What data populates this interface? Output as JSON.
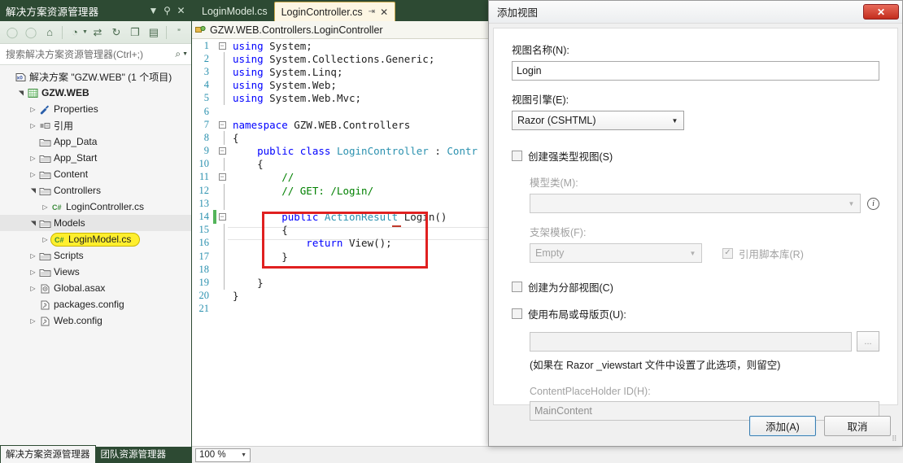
{
  "solution_explorer": {
    "title": "解决方案资源管理器",
    "header_icons": {
      "dropdown": "chevron-down-icon",
      "pin": "pin-icon",
      "close": "close-icon"
    },
    "toolbar": [
      {
        "name": "back-icon",
        "glyph": "↺"
      },
      {
        "name": "forward-icon",
        "glyph": "↻"
      },
      {
        "name": "home-icon",
        "glyph": "⌂"
      },
      {
        "name": "pending-changes-icon",
        "glyph": "◔"
      },
      {
        "name": "sync-with-active-document-icon",
        "glyph": "⇄"
      },
      {
        "name": "refresh-icon",
        "glyph": "↻"
      },
      {
        "name": "collapse-all-icon",
        "glyph": "⧉"
      },
      {
        "name": "show-all-files-icon",
        "glyph": "▤"
      },
      {
        "name": "properties-icon",
        "glyph": "»"
      }
    ],
    "search_placeholder": "搜索解决方案资源管理器(Ctrl+;)",
    "tree": [
      {
        "indent": 0,
        "expander": "",
        "icon": "solution-icon",
        "label": "解决方案 \"GZW.WEB\" (1 个项目)",
        "bold": false,
        "selected": false,
        "highlight": false
      },
      {
        "indent": 1,
        "expander": "▲",
        "icon": "project-icon",
        "label": "GZW.WEB",
        "bold": true,
        "selected": false,
        "highlight": false
      },
      {
        "indent": 2,
        "expander": "▷",
        "icon": "wrench-icon",
        "label": "Properties",
        "bold": false,
        "selected": false,
        "highlight": false
      },
      {
        "indent": 2,
        "expander": "▷",
        "icon": "references-icon",
        "label": "引用",
        "bold": false,
        "selected": false,
        "highlight": false
      },
      {
        "indent": 2,
        "expander": "",
        "icon": "folder-icon",
        "label": "App_Data",
        "bold": false,
        "selected": false,
        "highlight": false
      },
      {
        "indent": 2,
        "expander": "▷",
        "icon": "folder-icon",
        "label": "App_Start",
        "bold": false,
        "selected": false,
        "highlight": false
      },
      {
        "indent": 2,
        "expander": "▷",
        "icon": "folder-icon",
        "label": "Content",
        "bold": false,
        "selected": false,
        "highlight": false
      },
      {
        "indent": 2,
        "expander": "▲",
        "icon": "folder-icon",
        "label": "Controllers",
        "bold": false,
        "selected": false,
        "highlight": false
      },
      {
        "indent": 3,
        "expander": "▷",
        "icon": "csharp-icon",
        "label": "LoginController.cs",
        "bold": false,
        "selected": false,
        "highlight": false
      },
      {
        "indent": 2,
        "expander": "▲",
        "icon": "folder-icon",
        "label": "Models",
        "bold": false,
        "selected": true,
        "highlight": false
      },
      {
        "indent": 3,
        "expander": "▷",
        "icon": "csharp-icon",
        "label": "LoginModel.cs",
        "bold": false,
        "selected": false,
        "highlight": true
      },
      {
        "indent": 2,
        "expander": "▷",
        "icon": "folder-icon",
        "label": "Scripts",
        "bold": false,
        "selected": false,
        "highlight": false
      },
      {
        "indent": 2,
        "expander": "▷",
        "icon": "folder-icon",
        "label": "Views",
        "bold": false,
        "selected": false,
        "highlight": false
      },
      {
        "indent": 2,
        "expander": "▷",
        "icon": "asax-icon",
        "label": "Global.asax",
        "bold": false,
        "selected": false,
        "highlight": false
      },
      {
        "indent": 2,
        "expander": "",
        "icon": "config-icon",
        "label": "packages.config",
        "bold": false,
        "selected": false,
        "highlight": false
      },
      {
        "indent": 2,
        "expander": "▷",
        "icon": "config-icon",
        "label": "Web.config",
        "bold": false,
        "selected": false,
        "highlight": false
      }
    ],
    "bottom_tabs": [
      {
        "label": "解决方案资源管理器",
        "active": true
      },
      {
        "label": "团队资源管理器",
        "active": false
      }
    ]
  },
  "editor": {
    "tabs": [
      {
        "label": "LoginModel.cs",
        "active": false,
        "pinned": false
      },
      {
        "label": "LoginController.cs",
        "active": true,
        "pinned": true
      }
    ],
    "tab_pin_glyph": "⇥",
    "tab_close_glyph": "✕",
    "navbar": "GZW.WEB.Controllers.LoginController",
    "navbar_icon": "class-icon",
    "zoom_level": "100 %",
    "code_lines": [
      {
        "n": 1,
        "fold": "−",
        "guide": false,
        "changed": false,
        "segs": [
          {
            "t": "using ",
            "c": "kw"
          },
          {
            "t": "System;",
            "c": ""
          }
        ]
      },
      {
        "n": 2,
        "fold": "",
        "guide": true,
        "changed": false,
        "segs": [
          {
            "t": "using ",
            "c": "kw"
          },
          {
            "t": "System.Collections.Generic;",
            "c": ""
          }
        ]
      },
      {
        "n": 3,
        "fold": "",
        "guide": true,
        "changed": false,
        "segs": [
          {
            "t": "using ",
            "c": "kw"
          },
          {
            "t": "System.Linq;",
            "c": ""
          }
        ]
      },
      {
        "n": 4,
        "fold": "",
        "guide": true,
        "changed": false,
        "segs": [
          {
            "t": "using ",
            "c": "kw"
          },
          {
            "t": "System.Web;",
            "c": ""
          }
        ]
      },
      {
        "n": 5,
        "fold": "",
        "guide": true,
        "changed": false,
        "segs": [
          {
            "t": "using ",
            "c": "kw"
          },
          {
            "t": "System.Web.Mvc;",
            "c": ""
          }
        ]
      },
      {
        "n": 6,
        "fold": "",
        "guide": false,
        "changed": false,
        "segs": []
      },
      {
        "n": 7,
        "fold": "−",
        "guide": false,
        "changed": false,
        "segs": [
          {
            "t": "namespace ",
            "c": "kw"
          },
          {
            "t": "GZW.WEB.Controllers",
            "c": ""
          }
        ]
      },
      {
        "n": 8,
        "fold": "",
        "guide": true,
        "changed": false,
        "segs": [
          {
            "t": "{",
            "c": ""
          }
        ]
      },
      {
        "n": 9,
        "fold": "−",
        "guide": true,
        "changed": false,
        "segs": [
          {
            "t": "    public class ",
            "c": "kw"
          },
          {
            "t": "LoginController",
            "c": "ty"
          },
          {
            "t": " : ",
            "c": ""
          },
          {
            "t": "Contr",
            "c": "ty"
          }
        ]
      },
      {
        "n": 10,
        "fold": "",
        "guide": true,
        "changed": false,
        "segs": [
          {
            "t": "    {",
            "c": ""
          }
        ]
      },
      {
        "n": 11,
        "fold": "−",
        "guide": true,
        "changed": false,
        "segs": [
          {
            "t": "        //",
            "c": "cm"
          }
        ]
      },
      {
        "n": 12,
        "fold": "",
        "guide": true,
        "changed": false,
        "segs": [
          {
            "t": "        // GET: /Login/",
            "c": "cm"
          }
        ]
      },
      {
        "n": 13,
        "fold": "",
        "guide": true,
        "changed": false,
        "segs": []
      },
      {
        "n": 14,
        "fold": "−",
        "guide": true,
        "changed": true,
        "segs": [
          {
            "t": "        public ",
            "c": "kw"
          },
          {
            "t": "ActionResult",
            "c": "ty"
          },
          {
            "t": " Login()",
            "c": ""
          }
        ]
      },
      {
        "n": 15,
        "fold": "",
        "guide": true,
        "changed": false,
        "segs": [
          {
            "t": "        {",
            "c": ""
          }
        ]
      },
      {
        "n": 16,
        "fold": "",
        "guide": true,
        "changed": false,
        "segs": [
          {
            "t": "            return ",
            "c": "kw"
          },
          {
            "t": "View();",
            "c": ""
          }
        ]
      },
      {
        "n": 17,
        "fold": "",
        "guide": true,
        "changed": false,
        "segs": [
          {
            "t": "        }",
            "c": ""
          }
        ]
      },
      {
        "n": 18,
        "fold": "",
        "guide": true,
        "changed": false,
        "segs": []
      },
      {
        "n": 19,
        "fold": "",
        "guide": true,
        "changed": false,
        "segs": [
          {
            "t": "    }",
            "c": ""
          }
        ]
      },
      {
        "n": 20,
        "fold": "",
        "guide": false,
        "changed": false,
        "segs": [
          {
            "t": "}",
            "c": ""
          }
        ]
      },
      {
        "n": 21,
        "fold": "",
        "guide": false,
        "changed": false,
        "segs": []
      }
    ],
    "annotation": {
      "name": "red-highlight-box",
      "color": "#e02020"
    }
  },
  "dialog": {
    "title": "添加视图",
    "close_glyph": "✕",
    "view_name_label": "视图名称(N):",
    "view_name_value": "Login",
    "view_engine_label": "视图引擎(E):",
    "view_engine_value": "Razor (CSHTML)",
    "strongly_typed_label": "创建强类型视图(S)",
    "strongly_typed_checked": false,
    "model_class_label": "模型类(M):",
    "model_class_value": "",
    "info_glyph": "i",
    "scaffold_label": "支架模板(F):",
    "scaffold_value": "Empty",
    "reference_scripts_label": "引用脚本库(R)",
    "reference_scripts_checked": true,
    "partial_view_label": "创建为分部视图(C)",
    "partial_view_checked": false,
    "use_layout_label": "使用布局或母版页(U):",
    "use_layout_checked": false,
    "layout_path_value": "",
    "browse_label": "...",
    "layout_hint": "(如果在 Razor _viewstart 文件中设置了此选项，则留空)",
    "placeholder_id_label": "ContentPlaceHolder ID(H):",
    "placeholder_id_value": "MainContent",
    "add_button": "添加(A)",
    "cancel_button": "取消",
    "resize_grip": "⠿"
  },
  "colors": {
    "vs_chrome_green": "#2d4a33",
    "active_tab_cream": "#fdf6e3",
    "highlight_yellow": "#ffef2e",
    "annotation_red": "#e02020",
    "keyword_blue": "#0000ff",
    "type_teal": "#2b91af",
    "comment_green": "#008000"
  }
}
